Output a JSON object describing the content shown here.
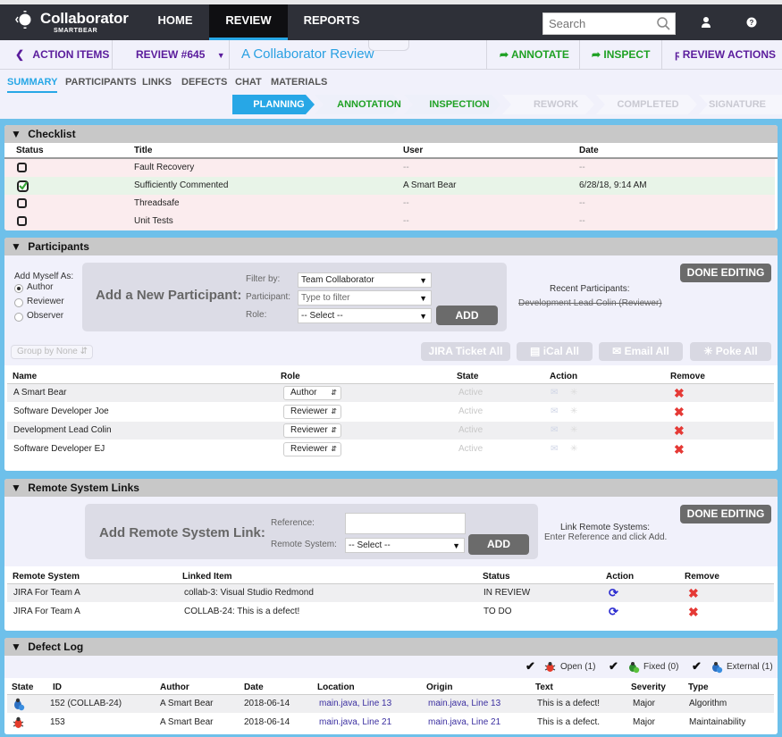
{
  "navbar": {
    "brand": "Collaborator",
    "brand_sub": "SMARTBEAR",
    "tabs": [
      {
        "label": "HOME",
        "active": false
      },
      {
        "label": "REVIEW",
        "active": true
      },
      {
        "label": "REPORTS",
        "active": false
      }
    ],
    "search_placeholder": "Search",
    "icons": [
      "user-icon",
      "help-icon"
    ]
  },
  "subbar": {
    "back_label": "ACTION ITEMS",
    "review_id": "REVIEW #645",
    "review_title": "A Collaborator Review",
    "actions": [
      {
        "label": "ANNOTATE",
        "icon": "share-arrow-icon"
      },
      {
        "label": "INSPECT",
        "icon": "share-arrow-icon"
      },
      {
        "label": "REVIEW ACTIONS",
        "icon": "lightning-icon"
      }
    ]
  },
  "section_tabs": [
    {
      "label": "SUMMARY",
      "active": true
    },
    {
      "label": "PARTICIPANTS",
      "active": false
    },
    {
      "label": "LINKS",
      "active": false
    },
    {
      "label": "DEFECTS",
      "active": false
    },
    {
      "label": "CHAT",
      "active": false
    },
    {
      "label": "MATERIALS",
      "active": false
    }
  ],
  "phases": [
    {
      "label": "PLANNING",
      "state": "current"
    },
    {
      "label": "ANNOTATION",
      "state": "available"
    },
    {
      "label": "INSPECTION",
      "state": "available"
    },
    {
      "label": "REWORK",
      "state": "disabled"
    },
    {
      "label": "COMPLETED",
      "state": "disabled"
    },
    {
      "label": "SIGNATURE",
      "state": "disabled"
    }
  ],
  "checklist": {
    "title": "Checklist",
    "columns": [
      "Status",
      "Title",
      "User",
      "Date"
    ],
    "rows": [
      {
        "checked": false,
        "title": "Fault Recovery",
        "user": "--",
        "date": "--"
      },
      {
        "checked": true,
        "title": "Sufficiently Commented",
        "user": "A Smart Bear",
        "date": "6/28/18, 9:14 AM"
      },
      {
        "checked": false,
        "title": "Threadsafe",
        "user": "--",
        "date": "--"
      },
      {
        "checked": false,
        "title": "Unit Tests",
        "user": "--",
        "date": "--"
      }
    ]
  },
  "participants": {
    "title": "Participants",
    "add_myself_label": "Add Myself As:",
    "add_myself_options": [
      {
        "label": "Author",
        "selected": true
      },
      {
        "label": "Reviewer",
        "selected": false
      },
      {
        "label": "Observer",
        "selected": false
      }
    ],
    "add_new_label": "Add a New Participant:",
    "filter_label": "Filter by:",
    "filter_value": "Team Collaborator",
    "participant_label": "Participant:",
    "participant_placeholder": "Type to filter",
    "role_label": "Role:",
    "role_value": "-- Select --",
    "add_button": "ADD",
    "done_button": "DONE EDITING",
    "recent_label": "Recent Participants:",
    "recent_items": [
      "Development Lead Colin (Reviewer)"
    ],
    "group_by": "Group by None",
    "bulk_buttons": [
      "JIRA Ticket All",
      "iCal All",
      "Email All",
      "Poke All"
    ],
    "columns": [
      "Name",
      "Role",
      "State",
      "Action",
      "Remove"
    ],
    "rows": [
      {
        "name": "A Smart Bear",
        "role": "Author",
        "state": "Active"
      },
      {
        "name": "Software Developer Joe",
        "role": "Reviewer",
        "state": "Active"
      },
      {
        "name": "Development Lead Colin",
        "role": "Reviewer",
        "state": "Active"
      },
      {
        "name": "Software Developer EJ",
        "role": "Reviewer",
        "state": "Active"
      }
    ]
  },
  "remote_links": {
    "title": "Remote System Links",
    "add_label": "Add Remote System Link:",
    "reference_label": "Reference:",
    "reference_value": "",
    "remote_system_label": "Remote System:",
    "remote_system_value": "-- Select --",
    "add_button": "ADD",
    "done_button": "DONE EDITING",
    "hint_title": "Link Remote Systems:",
    "hint_text": "Enter Reference and click Add.",
    "columns": [
      "Remote System",
      "Linked Item",
      "Status",
      "Action",
      "Remove"
    ],
    "rows": [
      {
        "system": "JIRA For Team A",
        "item": "collab-3: Visual Studio Redmond",
        "status": "IN REVIEW"
      },
      {
        "system": "JIRA For Team A",
        "item": "COLLAB-24: This is a defect!",
        "status": "TO DO"
      }
    ]
  },
  "defect_log": {
    "title": "Defect Log",
    "filters": [
      {
        "label": "Open (1)",
        "checked": true,
        "icon": "bug-open-icon"
      },
      {
        "label": "Fixed (0)",
        "checked": true,
        "icon": "bug-fixed-icon"
      },
      {
        "label": "External (1)",
        "checked": true,
        "icon": "bug-external-icon"
      }
    ],
    "columns": [
      "State",
      "ID",
      "Author",
      "Date",
      "Location",
      "Origin",
      "Text",
      "Severity",
      "Type"
    ],
    "rows": [
      {
        "state": "external",
        "id": "152 (COLLAB-24)",
        "author": "A Smart Bear",
        "date": "2018-06-14",
        "location": "main.java, Line 13",
        "origin": "main.java, Line 13",
        "text": "This is a defect!",
        "severity": "Major",
        "type": "Algorithm"
      },
      {
        "state": "open",
        "id": "153",
        "author": "A Smart Bear",
        "date": "2018-06-14",
        "location": "main.java, Line 21",
        "origin": "main.java, Line 21",
        "text": "This is a defect.",
        "severity": "Major",
        "type": "Maintainability"
      }
    ]
  },
  "colors": {
    "accent_blue": "#27a7e6",
    "purple": "#5a1c9c",
    "green": "#1fa124",
    "remove_red": "#e53935",
    "frame_blue": "#6ec0ea"
  }
}
